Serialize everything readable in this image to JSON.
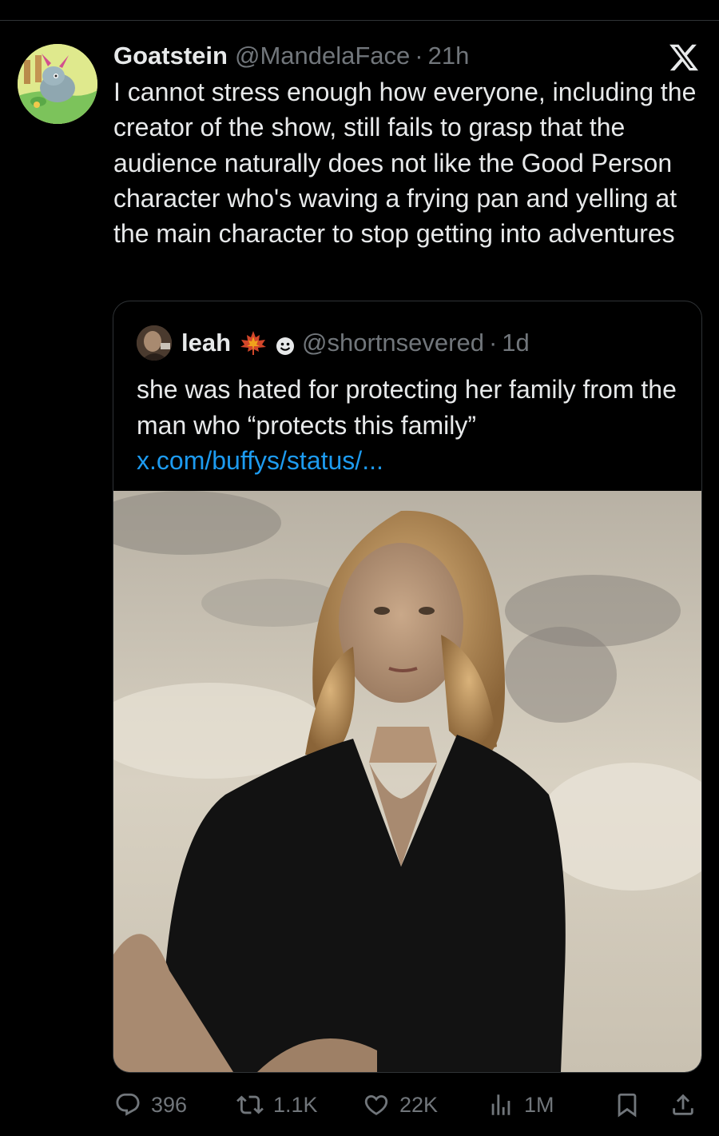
{
  "tweet": {
    "author_name": "Goatstein",
    "author_handle": "@MandelaFace",
    "separator": "·",
    "time": "21h",
    "text": "I cannot stress enough how everyone, including the creator of the show, still fails to grasp that the audience naturally does not like the Good Person character who's waving a frying pan and yelling at the main character to stop getting into adventures"
  },
  "quoted": {
    "author_name": "leah",
    "author_handle": "@shortnsevered",
    "separator": "·",
    "time": "1d",
    "text": "she was hated for protecting her family from the man who “protects this family” ",
    "link": "x.com/buffys/status/..."
  },
  "actions": {
    "replies": "396",
    "reposts": "1.1K",
    "likes": "22K",
    "views": "1M"
  },
  "icons": {
    "brand": "x-logo-icon",
    "reply": "reply-icon",
    "repost": "repost-icon",
    "like": "heart-icon",
    "views": "views-chart-icon",
    "bookmark": "bookmark-icon",
    "share": "share-icon"
  },
  "colors": {
    "background": "#000000",
    "text": "#e7e9ea",
    "muted": "#71767b",
    "link": "#1d9bf0",
    "border": "#2f3336"
  }
}
